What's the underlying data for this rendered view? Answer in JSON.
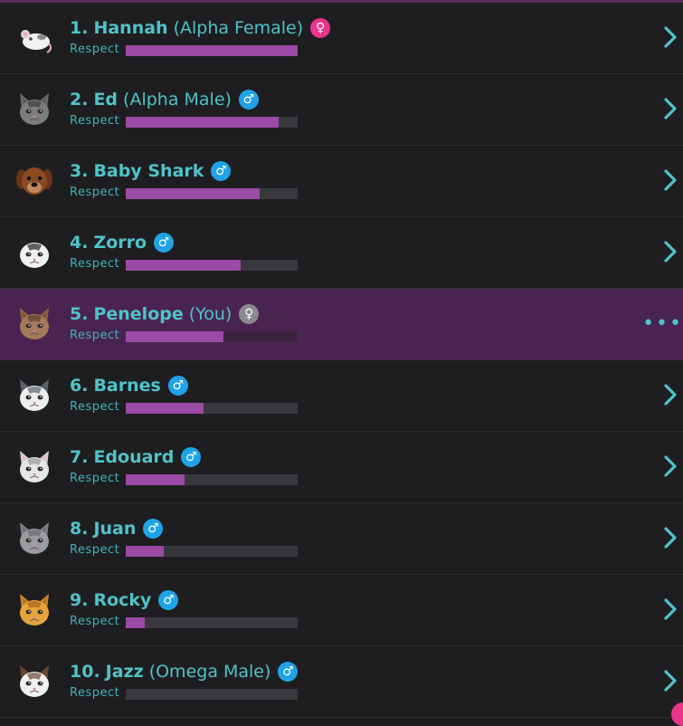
{
  "respect_label": "Respect",
  "colors": {
    "accent": "#4fc3c8",
    "bar": "#9b4aa6",
    "highlight": "#4a2450",
    "male": "#1fa3e6",
    "female": "#e8348a"
  },
  "members": [
    {
      "rank": "1.",
      "name": "Hannah",
      "title": "(Alpha Female)",
      "gender": "female",
      "symbol": "♀",
      "respect": 1.0,
      "avatar": "rat",
      "action": "chevron"
    },
    {
      "rank": "2.",
      "name": "Ed",
      "title": "(Alpha Male)",
      "gender": "male",
      "symbol": "♂",
      "respect": 0.89,
      "avatar": "gray-tabby-cat",
      "action": "chevron"
    },
    {
      "rank": "3.",
      "name": "Baby Shark",
      "title": "",
      "gender": "male",
      "symbol": "♂",
      "respect": 0.78,
      "avatar": "brown-dog",
      "action": "chevron"
    },
    {
      "rank": "4.",
      "name": "Zorro",
      "title": "",
      "gender": "male",
      "symbol": "♂",
      "respect": 0.67,
      "avatar": "black-white-cat",
      "action": "chevron"
    },
    {
      "rank": "5.",
      "name": "Penelope",
      "title": "(You)",
      "gender": "you",
      "symbol": "♀",
      "respect": 0.57,
      "avatar": "tabby-cat",
      "action": "dots"
    },
    {
      "rank": "6.",
      "name": "Barnes",
      "title": "",
      "gender": "male",
      "symbol": "♂",
      "respect": 0.45,
      "avatar": "gray-white-cat",
      "action": "chevron"
    },
    {
      "rank": "7.",
      "name": "Edouard",
      "title": "",
      "gender": "male",
      "symbol": "♂",
      "respect": 0.34,
      "avatar": "white-cat",
      "action": "chevron"
    },
    {
      "rank": "8.",
      "name": "Juan",
      "title": "",
      "gender": "male",
      "symbol": "♂",
      "respect": 0.22,
      "avatar": "gray-cat",
      "action": "chevron"
    },
    {
      "rank": "9.",
      "name": "Rocky",
      "title": "",
      "gender": "male",
      "symbol": "♂",
      "respect": 0.11,
      "avatar": "orange-cat",
      "action": "chevron"
    },
    {
      "rank": "10.",
      "name": "Jazz",
      "title": "(Omega Male)",
      "gender": "male",
      "symbol": "♂",
      "respect": 0.0,
      "avatar": "brown-white-cat",
      "action": "chevron"
    }
  ]
}
